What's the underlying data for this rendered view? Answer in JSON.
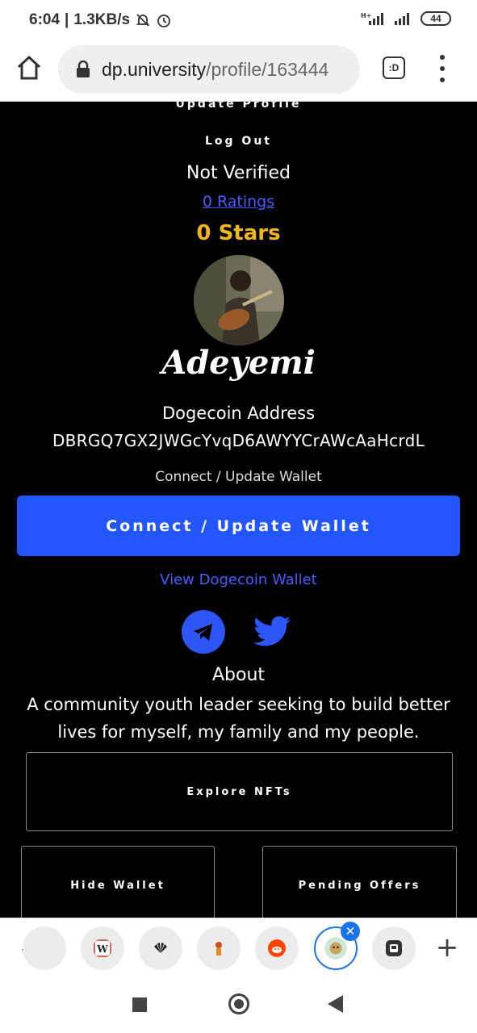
{
  "status_bar": {
    "time": "6:04",
    "separator": "|",
    "speed": "1.3KB/s",
    "battery": "44"
  },
  "browser": {
    "url_domain": "dp.university",
    "url_path": "/profile/163444",
    "tab_count": ":D"
  },
  "profile": {
    "update_profile": "Update Profile",
    "log_out": "Log Out",
    "verification": "Not Verified",
    "ratings": "0 Ratings",
    "stars": "0 Stars",
    "name": "Adeyemi",
    "address_label": "Dogecoin Address",
    "address_value": "DBRGQ7GX2JWGcYvqD6AWYYCrAWcAaHcrdL",
    "wallet_hint": "Connect / Update Wallet",
    "wallet_button": "Connect / Update Wallet",
    "view_wallet": "View Dogecoin Wallet",
    "about_title": "About",
    "about_text": "A community youth leader seeking to build better lives for myself, my family and my people.",
    "explore_nfts": "Explore NFTs",
    "hide_wallet": "Hide Wallet",
    "pending_offers": "Pending Offers"
  },
  "social_icons": [
    "telegram-icon",
    "twitter-icon"
  ],
  "tab_strip": {
    "favicons": [
      "wiki-favicon",
      "nbc-favicon",
      "game-favicon",
      "reddit-favicon",
      "doge-favicon",
      "dark-app-favicon"
    ]
  },
  "colors": {
    "accent_blue": "#2356ff",
    "link_blue": "#4b5cff",
    "stars_gold": "#f2b51c"
  }
}
